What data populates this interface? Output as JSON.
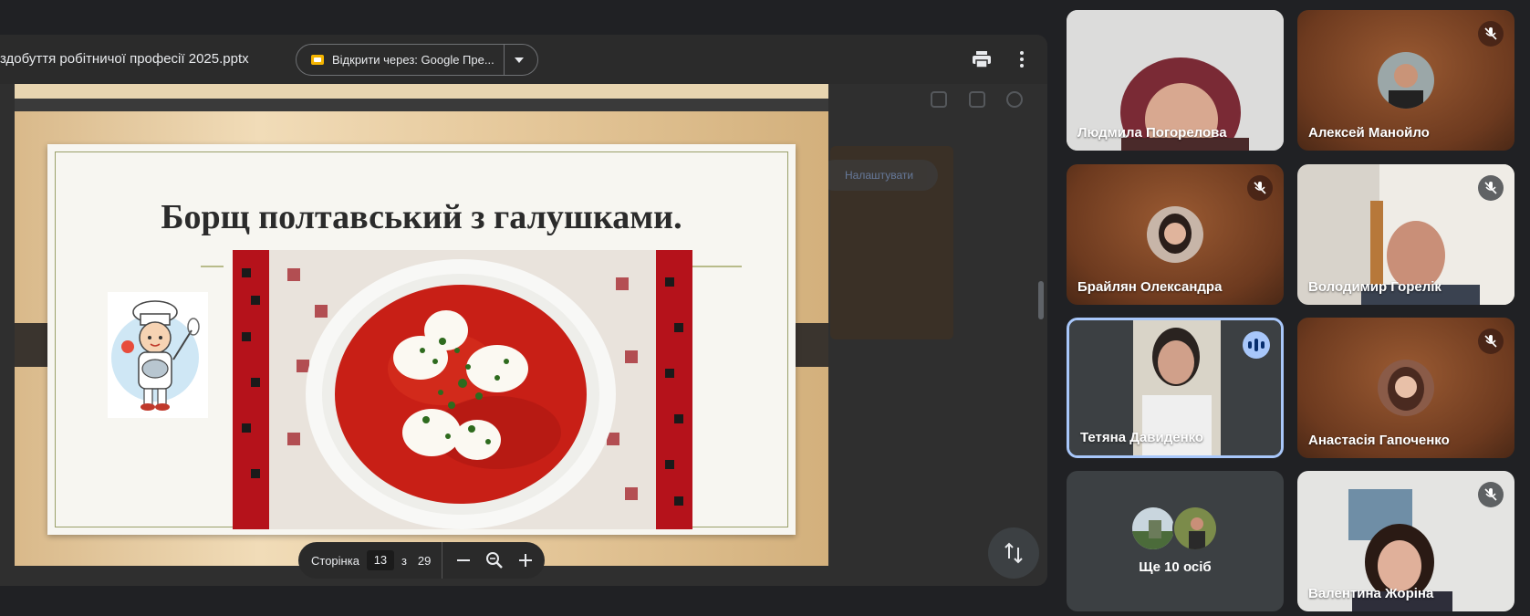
{
  "viewer": {
    "file_name": "здобуття робітничої професії 2025.pptx",
    "open_with_label": "Відкрити через: Google Пре...",
    "print_icon": "print-icon",
    "menu_icon": "more-vert-icon"
  },
  "background_ui": {
    "chip_label": "Налаштувати"
  },
  "slide": {
    "title": "Борщ полтавський з галушками."
  },
  "page_controls": {
    "label": "Сторінка",
    "current": "13",
    "of": "з",
    "total": "29"
  },
  "participants": [
    {
      "name": "Людмила Погорелова",
      "muted": false
    },
    {
      "name": "Алексей Манойло",
      "muted": true
    },
    {
      "name": "Брайлян Олександра",
      "muted": true
    },
    {
      "name": "Володимир Горелік",
      "muted": true
    },
    {
      "name": "Тетяна Давиденко",
      "muted": false,
      "speaking": true
    },
    {
      "name": "Анастасія Гапоченко",
      "muted": true
    },
    {
      "name": "Валентина Жоріна",
      "muted": true
    }
  ],
  "more_participants": {
    "label": "Ще 10 осіб"
  },
  "colors": {
    "background": "#202124",
    "speaking_accent": "#a8c7fa",
    "tile": "#3c4043"
  }
}
